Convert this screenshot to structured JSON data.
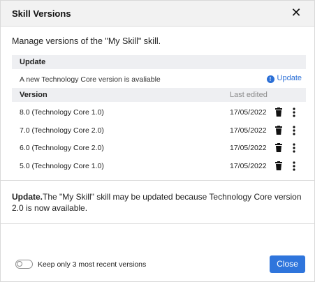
{
  "dialog": {
    "title": "Skill Versions",
    "close_glyph": "✕",
    "intro": "Manage versions of the \"My Skill\" skill."
  },
  "update_section": {
    "heading": "Update",
    "message": "A new Technology Core version is avaliable",
    "link_label": "Update",
    "link_icon": "info-icon"
  },
  "versions": {
    "col_version": "Version",
    "col_last_edited": "Last edited",
    "rows": [
      {
        "name": "8.0 (Technology Core 1.0)",
        "date": "17/05/2022"
      },
      {
        "name": "7.0 (Technology Core 2.0)",
        "date": "17/05/2022"
      },
      {
        "name": "6.0 (Technology Core 2.0)",
        "date": "17/05/2022"
      },
      {
        "name": "5.0 (Technology Core 1.0)",
        "date": "17/05/2022"
      }
    ],
    "row_icons": [
      "trash-icon",
      "more-vertical-icon"
    ]
  },
  "note": {
    "bold": "Update.",
    "text": "The \"My Skill\" skill may be updated because Technology Core version 2.0 is now available."
  },
  "footer": {
    "toggle_label": "Keep only 3 most recent versions",
    "toggle_on": false,
    "close_label": "Close"
  },
  "colors": {
    "accent": "#2f75dc",
    "header_bg": "#f2f2f2",
    "section_bg": "#eeeff2"
  }
}
